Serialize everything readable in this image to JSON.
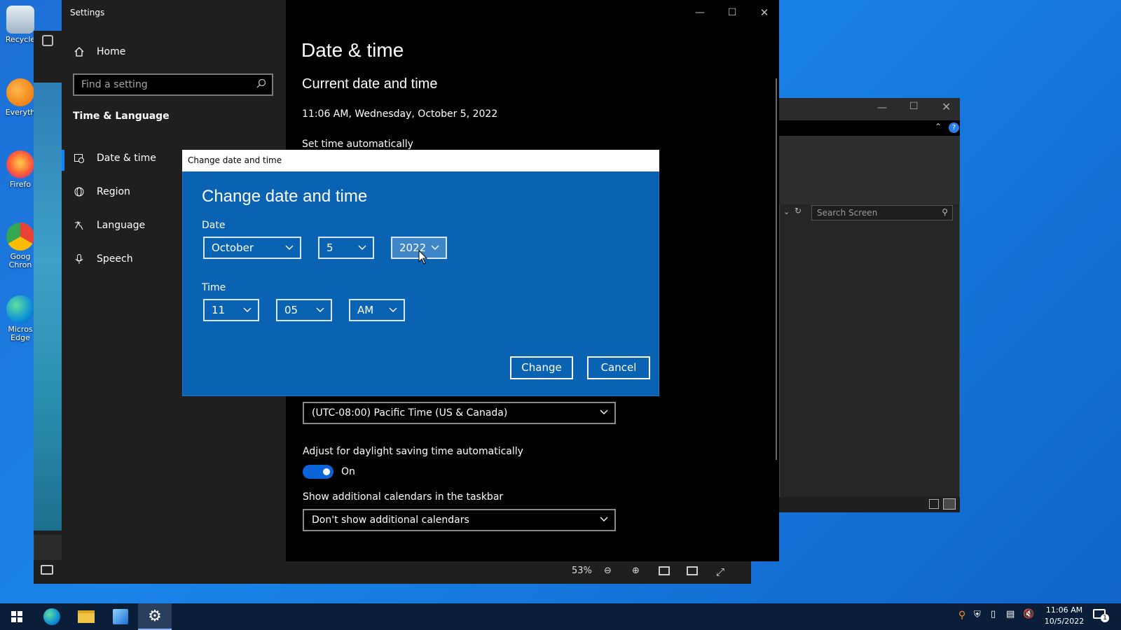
{
  "desktop": {
    "icons": [
      {
        "label": "Recycle"
      },
      {
        "label": "Everyth"
      },
      {
        "label": "Firefo"
      },
      {
        "label": "Goog Chron"
      },
      {
        "label": "Micros Edge"
      }
    ]
  },
  "viewer": {
    "zoom": "53%"
  },
  "background_window": {
    "search_placeholder": "Search Screen"
  },
  "settings": {
    "window_title": "Settings",
    "home_label": "Home",
    "search_placeholder": "Find a setting",
    "section_title": "Time & Language",
    "nav": [
      {
        "label": "Date & time",
        "icon": "clock-calendar-icon",
        "selected": true
      },
      {
        "label": "Region",
        "icon": "globe-icon"
      },
      {
        "label": "Language",
        "icon": "language-icon"
      },
      {
        "label": "Speech",
        "icon": "microphone-icon"
      }
    ],
    "page_title": "Date & time",
    "current_heading": "Current date and time",
    "current_datetime": "11:06 AM, Wednesday, October 5, 2022",
    "set_time_auto_label": "Set time automatically",
    "timezone_value": "(UTC-08:00) Pacific Time (US & Canada)",
    "dst_label": "Adjust for daylight saving time automatically",
    "dst_state": "On",
    "calendars_label": "Show additional calendars in the taskbar",
    "calendars_value": "Don't show additional calendars"
  },
  "dialog": {
    "titlebar": "Change date and time",
    "heading": "Change date and time",
    "date_label": "Date",
    "month": "October",
    "day": "5",
    "year": "2022",
    "time_label": "Time",
    "hour": "11",
    "minute": "05",
    "ampm": "AM",
    "change_button": "Change",
    "cancel_button": "Cancel"
  },
  "taskbar": {
    "time": "11:06 AM",
    "date": "10/5/2022",
    "notification_count": "1"
  },
  "colors": {
    "accent": "#0a64d8",
    "dialog_bg": "#0a62b3",
    "settings_bg": "#000000",
    "sidebar_bg": "#1f1f1f"
  }
}
